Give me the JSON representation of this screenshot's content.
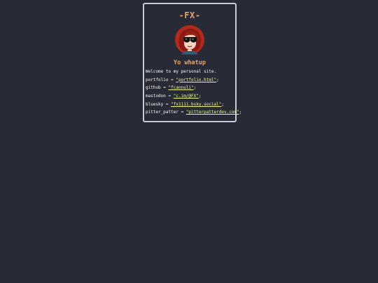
{
  "site": {
    "title": "-FX-",
    "greeting": "Yo whatup",
    "intro": "Welcome to my personal site."
  },
  "links": [
    {
      "key": "portfolio",
      "value": "\"portfolio.html\""
    },
    {
      "key": "github",
      "value": "\"fcannuli\""
    },
    {
      "key": "mastodon",
      "value": "\"c.im/@FX\""
    },
    {
      "key": "bluesky",
      "value": "\"fx1111.bsky.social\""
    },
    {
      "key": "pitter_patter",
      "value": "\"pitterpatterdev.com\""
    }
  ],
  "syntax": {
    "assign": " = ",
    "terminator": ";"
  },
  "colors": {
    "background": "#282a36",
    "accent": "#f0a35e",
    "string": "#f1fa8c",
    "text": "#f8f8f2",
    "border": "#c9ccd6"
  },
  "icons": {
    "avatar": "avatar-cartoon-sunglasses-icon"
  }
}
